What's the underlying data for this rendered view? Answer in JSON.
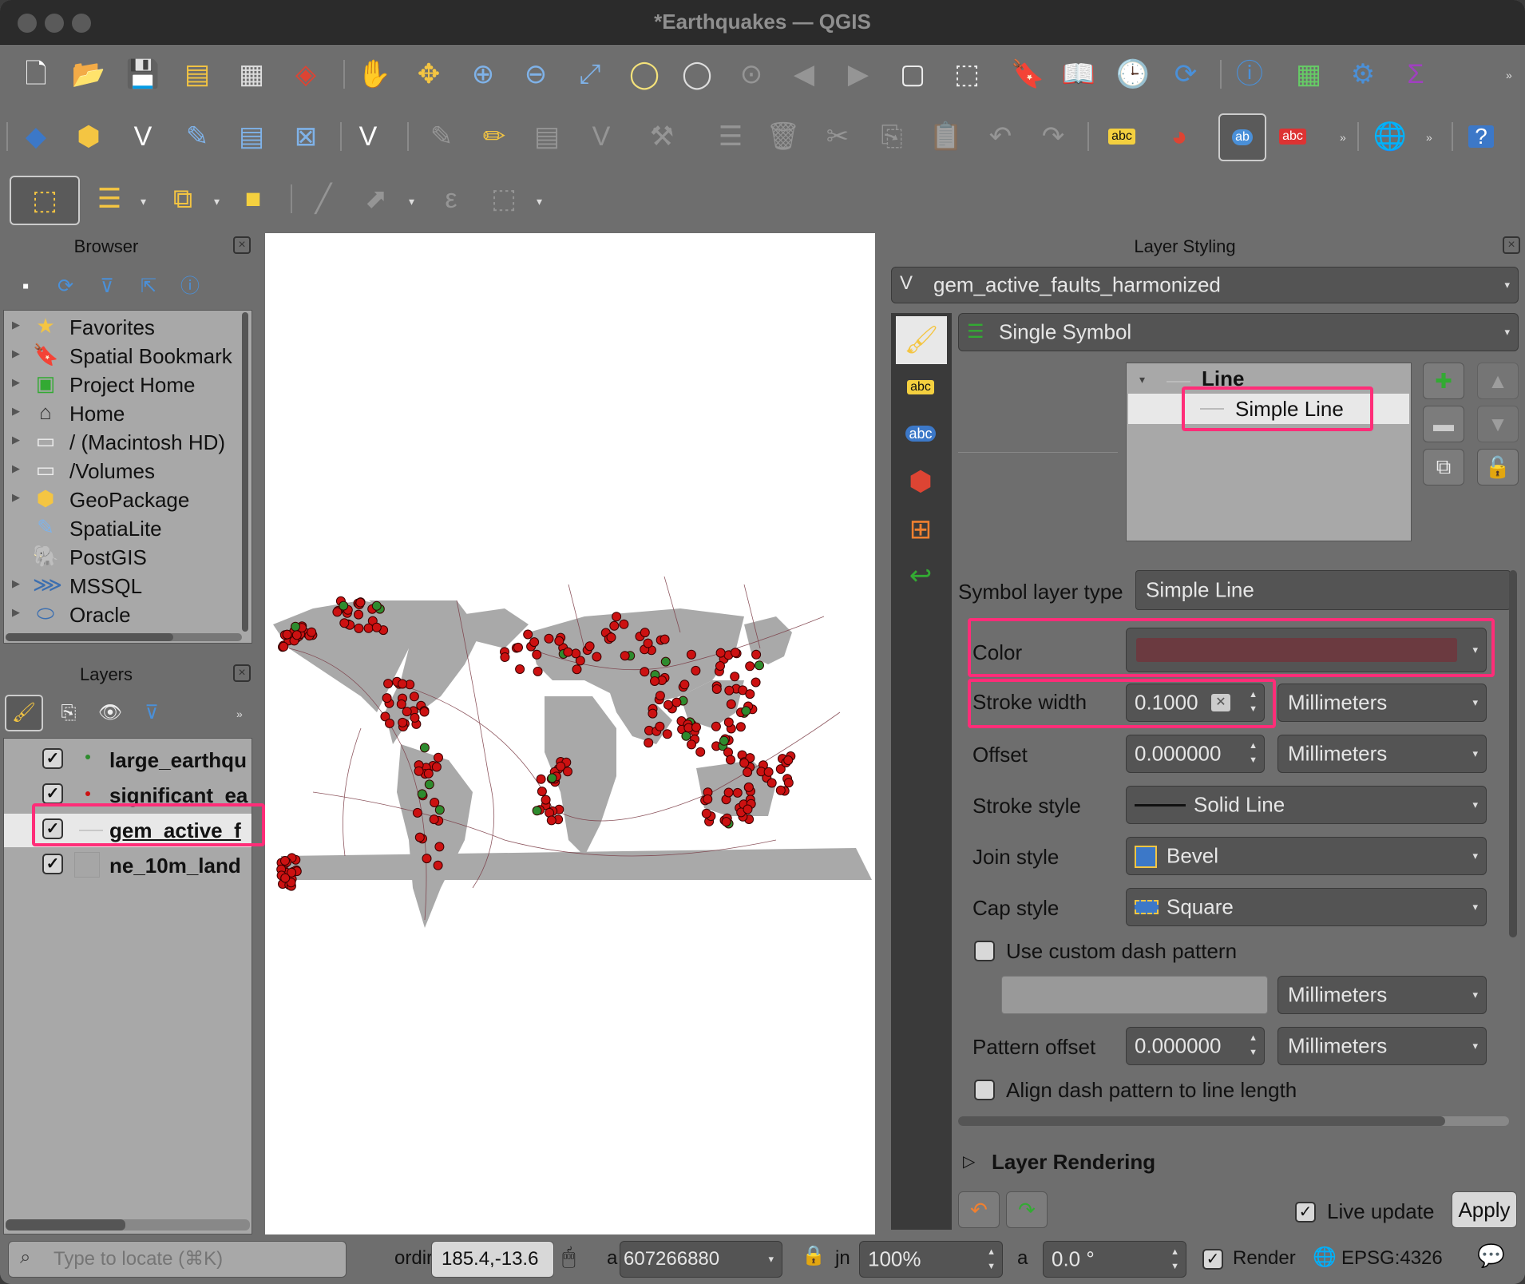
{
  "window": {
    "title": "*Earthquakes — QGIS"
  },
  "toolbar": {
    "row1": [
      "new-project-icon",
      "open-project-icon",
      "save-project-icon",
      "print-layout-icon",
      "layout-manager-icon",
      "style-manager-icon",
      "pan-hand-icon",
      "pan-to-selection-icon",
      "zoom-in-icon",
      "zoom-out-icon",
      "zoom-full-icon",
      "zoom-to-selection-icon",
      "zoom-to-layer-icon",
      "zoom-native-icon",
      "zoom-last-icon",
      "zoom-next-icon",
      "new-map-view-icon",
      "new-3d-view-icon",
      "new-bookmark-icon",
      "show-bookmarks-icon",
      "temporal-controller-icon",
      "refresh-icon",
      "identify-icon",
      "attribute-table-icon",
      "processing-toolbox-icon",
      "statistics-icon"
    ],
    "row2": [
      "data-source-manager-icon",
      "new-geopackage-layer-icon",
      "new-shapefile-layer-icon",
      "new-spatialite-layer-icon",
      "new-temporary-layer-icon",
      "new-virtual-layer-icon",
      "digitizing-icon",
      "current-edits-icon",
      "toggle-editing-icon",
      "save-edits-icon",
      "add-feature-icon",
      "vertex-tool-icon",
      "modify-attributes-icon",
      "delete-selected-icon",
      "cut-features-icon",
      "copy-features-icon",
      "paste-features-icon",
      "undo-icon",
      "redo-icon",
      "label-toolbar-icon",
      "diagram-toolbar-icon",
      "pin-labels-icon",
      "show-hide-labels-icon",
      "metasearch-icon",
      "help-icon"
    ],
    "row3": [
      "select-features-icon",
      "select-by-value-icon",
      "deselect-icon",
      "select-by-location-icon",
      "measure-icon",
      "identify-features-icon",
      "expression-icon",
      "attributes-form-icon"
    ]
  },
  "browser": {
    "title": "Browser",
    "items": [
      {
        "label": "Favorites",
        "icon": "star-icon"
      },
      {
        "label": "Spatial Bookmark",
        "icon": "bookmark-icon"
      },
      {
        "label": "Project Home",
        "icon": "project-home-icon"
      },
      {
        "label": "Home",
        "icon": "home-icon"
      },
      {
        "label": "/ (Macintosh HD)",
        "icon": "folder-icon"
      },
      {
        "label": "/Volumes",
        "icon": "folder-icon"
      },
      {
        "label": "GeoPackage",
        "icon": "geopackage-icon"
      },
      {
        "label": "SpatiaLite",
        "icon": "spatialite-icon"
      },
      {
        "label": "PostGIS",
        "icon": "postgis-icon"
      },
      {
        "label": "MSSQL",
        "icon": "mssql-icon"
      },
      {
        "label": "Oracle",
        "icon": "oracle-icon"
      }
    ]
  },
  "layers": {
    "title": "Layers",
    "items": [
      {
        "label": "large_earthqu",
        "checked": true,
        "symbol": "#2e8b2e"
      },
      {
        "label": "significant_ea",
        "checked": true,
        "symbol": "#cc1111"
      },
      {
        "label": "gem_active_f",
        "checked": true,
        "symbol": "#c8c8c8"
      },
      {
        "label": "ne_10m_land",
        "checked": true,
        "symbol": "#a6a6a6"
      }
    ]
  },
  "styling": {
    "title": "Layer Styling",
    "layer": "gem_active_faults_harmonized",
    "renderer": "Single Symbol",
    "tree": {
      "root": "Line",
      "child": "Simple Line"
    },
    "symbol_layer_type_label": "Symbol layer type",
    "symbol_layer_type": "Simple Line",
    "color_label": "Color",
    "color_value": "#6b3a40",
    "stroke_width_label": "Stroke width",
    "stroke_width": "0.1000",
    "stroke_width_unit": "Millimeters",
    "offset_label": "Offset",
    "offset": "0.000000",
    "offset_unit": "Millimeters",
    "stroke_style_label": "Stroke style",
    "stroke_style": "Solid Line",
    "join_style_label": "Join style",
    "join_style": "Bevel",
    "cap_style_label": "Cap style",
    "cap_style": "Square",
    "custom_dash_label": "Use custom dash pattern",
    "dash_unit": "Millimeters",
    "pattern_offset_label": "Pattern offset",
    "pattern_offset": "0.000000",
    "pattern_offset_unit": "Millimeters",
    "align_dash_label": "Align dash pattern to line length",
    "layer_rendering_label": "Layer Rendering",
    "live_update_label": "Live update",
    "apply_label": "Apply"
  },
  "statusbar": {
    "locate_placeholder": "Type to locate (⌘K)",
    "coord_label": "ordir",
    "coord_value": "185.4,-13.6",
    "scale_label": "a",
    "scale_value": "607266880",
    "magnifier_label": "jn",
    "magnifier_value": "100%",
    "rotation_label": "a",
    "rotation_value": "0.0 °",
    "render_label": "Render",
    "crs": "EPSG:4326"
  }
}
